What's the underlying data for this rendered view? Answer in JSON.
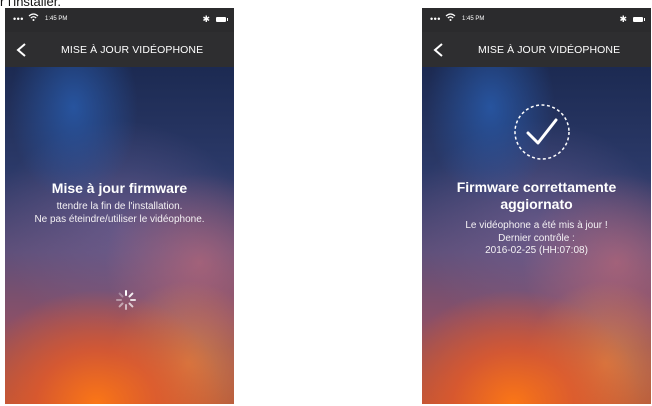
{
  "doc_fragment": "r l'installer.",
  "phones": [
    {
      "status": {
        "dots": "•••",
        "time": "1:45 PM"
      },
      "nav": {
        "title": "MISE À JOUR VIDÉOPHONE"
      },
      "heading": "Mise à jour firmware",
      "lines": [
        "ttendre la fin de l'installation.",
        "Ne pas éteindre/utiliser le vidéophone."
      ]
    },
    {
      "status": {
        "dots": "•••",
        "time": "1:45 PM"
      },
      "nav": {
        "title": "MISE À JOUR VIDÉOPHONE"
      },
      "heading_lines": [
        "Firmware correttamente",
        "aggiornato"
      ],
      "lines": [
        "Le vidéophone a été mis à jour !",
        "Dernier contrôle :",
        "2016-02-25 (HH:07:08)"
      ]
    }
  ],
  "colors": {
    "statusbar": "#2b2b2d",
    "navbar": "#2e2e30",
    "text": "#ffffff"
  },
  "icons": [
    "wifi-icon",
    "bluetooth-icon",
    "battery-icon",
    "back-chevron-icon",
    "loading-spinner-icon",
    "checkmark-circle-icon"
  ]
}
